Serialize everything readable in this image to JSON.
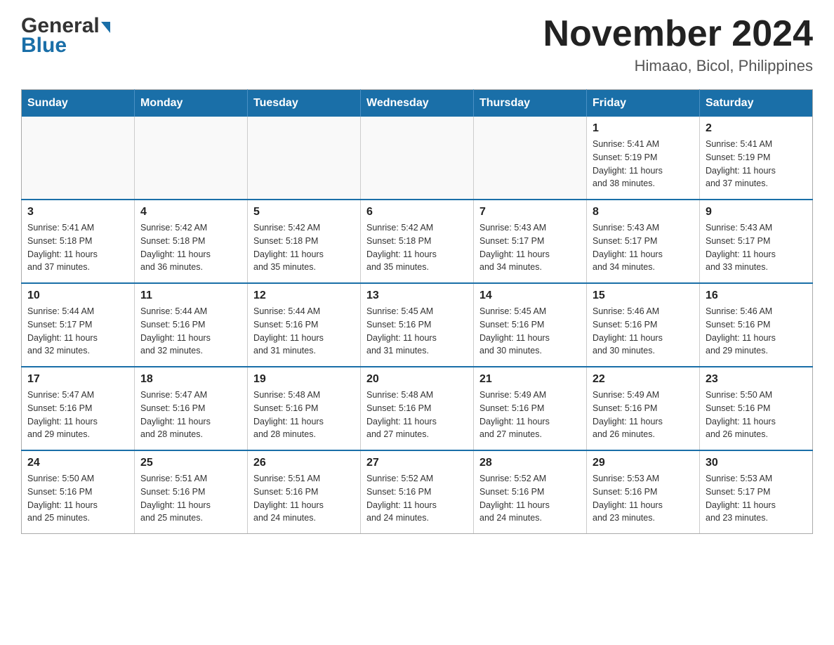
{
  "header": {
    "logo_general": "General",
    "logo_blue": "Blue",
    "month_title": "November 2024",
    "location": "Himaao, Bicol, Philippines"
  },
  "calendar": {
    "days_of_week": [
      "Sunday",
      "Monday",
      "Tuesday",
      "Wednesday",
      "Thursday",
      "Friday",
      "Saturday"
    ],
    "weeks": [
      [
        {
          "day": "",
          "info": ""
        },
        {
          "day": "",
          "info": ""
        },
        {
          "day": "",
          "info": ""
        },
        {
          "day": "",
          "info": ""
        },
        {
          "day": "",
          "info": ""
        },
        {
          "day": "1",
          "info": "Sunrise: 5:41 AM\nSunset: 5:19 PM\nDaylight: 11 hours\nand 38 minutes."
        },
        {
          "day": "2",
          "info": "Sunrise: 5:41 AM\nSunset: 5:19 PM\nDaylight: 11 hours\nand 37 minutes."
        }
      ],
      [
        {
          "day": "3",
          "info": "Sunrise: 5:41 AM\nSunset: 5:18 PM\nDaylight: 11 hours\nand 37 minutes."
        },
        {
          "day": "4",
          "info": "Sunrise: 5:42 AM\nSunset: 5:18 PM\nDaylight: 11 hours\nand 36 minutes."
        },
        {
          "day": "5",
          "info": "Sunrise: 5:42 AM\nSunset: 5:18 PM\nDaylight: 11 hours\nand 35 minutes."
        },
        {
          "day": "6",
          "info": "Sunrise: 5:42 AM\nSunset: 5:18 PM\nDaylight: 11 hours\nand 35 minutes."
        },
        {
          "day": "7",
          "info": "Sunrise: 5:43 AM\nSunset: 5:17 PM\nDaylight: 11 hours\nand 34 minutes."
        },
        {
          "day": "8",
          "info": "Sunrise: 5:43 AM\nSunset: 5:17 PM\nDaylight: 11 hours\nand 34 minutes."
        },
        {
          "day": "9",
          "info": "Sunrise: 5:43 AM\nSunset: 5:17 PM\nDaylight: 11 hours\nand 33 minutes."
        }
      ],
      [
        {
          "day": "10",
          "info": "Sunrise: 5:44 AM\nSunset: 5:17 PM\nDaylight: 11 hours\nand 32 minutes."
        },
        {
          "day": "11",
          "info": "Sunrise: 5:44 AM\nSunset: 5:16 PM\nDaylight: 11 hours\nand 32 minutes."
        },
        {
          "day": "12",
          "info": "Sunrise: 5:44 AM\nSunset: 5:16 PM\nDaylight: 11 hours\nand 31 minutes."
        },
        {
          "day": "13",
          "info": "Sunrise: 5:45 AM\nSunset: 5:16 PM\nDaylight: 11 hours\nand 31 minutes."
        },
        {
          "day": "14",
          "info": "Sunrise: 5:45 AM\nSunset: 5:16 PM\nDaylight: 11 hours\nand 30 minutes."
        },
        {
          "day": "15",
          "info": "Sunrise: 5:46 AM\nSunset: 5:16 PM\nDaylight: 11 hours\nand 30 minutes."
        },
        {
          "day": "16",
          "info": "Sunrise: 5:46 AM\nSunset: 5:16 PM\nDaylight: 11 hours\nand 29 minutes."
        }
      ],
      [
        {
          "day": "17",
          "info": "Sunrise: 5:47 AM\nSunset: 5:16 PM\nDaylight: 11 hours\nand 29 minutes."
        },
        {
          "day": "18",
          "info": "Sunrise: 5:47 AM\nSunset: 5:16 PM\nDaylight: 11 hours\nand 28 minutes."
        },
        {
          "day": "19",
          "info": "Sunrise: 5:48 AM\nSunset: 5:16 PM\nDaylight: 11 hours\nand 28 minutes."
        },
        {
          "day": "20",
          "info": "Sunrise: 5:48 AM\nSunset: 5:16 PM\nDaylight: 11 hours\nand 27 minutes."
        },
        {
          "day": "21",
          "info": "Sunrise: 5:49 AM\nSunset: 5:16 PM\nDaylight: 11 hours\nand 27 minutes."
        },
        {
          "day": "22",
          "info": "Sunrise: 5:49 AM\nSunset: 5:16 PM\nDaylight: 11 hours\nand 26 minutes."
        },
        {
          "day": "23",
          "info": "Sunrise: 5:50 AM\nSunset: 5:16 PM\nDaylight: 11 hours\nand 26 minutes."
        }
      ],
      [
        {
          "day": "24",
          "info": "Sunrise: 5:50 AM\nSunset: 5:16 PM\nDaylight: 11 hours\nand 25 minutes."
        },
        {
          "day": "25",
          "info": "Sunrise: 5:51 AM\nSunset: 5:16 PM\nDaylight: 11 hours\nand 25 minutes."
        },
        {
          "day": "26",
          "info": "Sunrise: 5:51 AM\nSunset: 5:16 PM\nDaylight: 11 hours\nand 24 minutes."
        },
        {
          "day": "27",
          "info": "Sunrise: 5:52 AM\nSunset: 5:16 PM\nDaylight: 11 hours\nand 24 minutes."
        },
        {
          "day": "28",
          "info": "Sunrise: 5:52 AM\nSunset: 5:16 PM\nDaylight: 11 hours\nand 24 minutes."
        },
        {
          "day": "29",
          "info": "Sunrise: 5:53 AM\nSunset: 5:16 PM\nDaylight: 11 hours\nand 23 minutes."
        },
        {
          "day": "30",
          "info": "Sunrise: 5:53 AM\nSunset: 5:17 PM\nDaylight: 11 hours\nand 23 minutes."
        }
      ]
    ]
  }
}
